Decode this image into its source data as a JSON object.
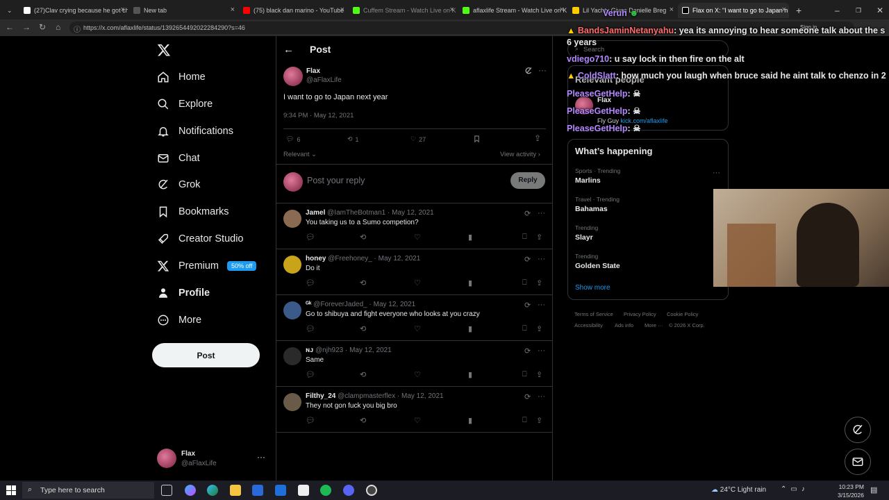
{
  "browser": {
    "tabs": [
      {
        "label": "(27)Clav crying because he got ch",
        "color": "#ffffff"
      },
      {
        "label": "New tab",
        "color": "#cccccc"
      },
      {
        "label": "(75) black dan marino - YouTube",
        "color": "#ff0000"
      },
      {
        "label": "Cuffem Stream - Watch Live on K",
        "color": "#53fc18"
      },
      {
        "label": "aflaxlife Stream - Watch Live on K",
        "color": "#53fc18"
      },
      {
        "label": "Lil Yachty Gives Danielle Breg",
        "color": "#ffcc00"
      },
      {
        "label": "Flax on X: \"I want to go to Japan n",
        "color": "#ffffff"
      }
    ],
    "url": "https://x.com/aflaxlife/status/1392654492022284290?s=46",
    "signin_label": "Sign in"
  },
  "nav": {
    "items": [
      {
        "label": "Home",
        "icon": "home-icon"
      },
      {
        "label": "Explore",
        "icon": "search-icon"
      },
      {
        "label": "Notifications",
        "icon": "bell-icon"
      },
      {
        "label": "Chat",
        "icon": "mail-icon"
      },
      {
        "label": "Grok",
        "icon": "grok-icon"
      },
      {
        "label": "Bookmarks",
        "icon": "bookmark-icon"
      },
      {
        "label": "Creator Studio",
        "icon": "rocket-icon"
      },
      {
        "label": "Premium",
        "icon": "x-icon",
        "badge": "50% off"
      },
      {
        "label": "Profile",
        "icon": "person-icon"
      },
      {
        "label": "More",
        "icon": "more-icon"
      }
    ],
    "post_label": "Post",
    "account": {
      "name": "Flax",
      "handle": "@aFlaxLife",
      "more": "···"
    }
  },
  "post": {
    "header_title": "Post",
    "author_name": "Flax",
    "author_handle": "@aFlaxLife",
    "text": "I want to go to Japan next year",
    "timestamp": "9:34 PM · May 12, 2021",
    "replies": "6",
    "reposts": "1",
    "likes": "27",
    "sort_label": "Relevant",
    "view_activity": "View activity",
    "reply_placeholder": "Post your reply",
    "reply_button": "Reply"
  },
  "replies": [
    {
      "name": "Jamel",
      "handle": "@IamTheBotman1",
      "date": "May 12, 2021",
      "text": "You taking us to a Sumo competion?",
      "color": "#8a6a50"
    },
    {
      "name": "honey",
      "handle": "@Freehoney_",
      "date": "May 12, 2021",
      "text": "Do it",
      "color": "#c9a31a"
    },
    {
      "name": "ᴳᵏ",
      "handle": "@ForeverJaded_",
      "date": "May 12, 2021",
      "text": "Go to shibuya and fight everyone who looks at you crazy",
      "color": "#3b5a8a"
    },
    {
      "name": "ɴᴊ",
      "handle": "@njh923",
      "date": "May 12, 2021",
      "text": "Same",
      "color": "#2a2a2a"
    },
    {
      "name": "Filthy_24",
      "handle": "@clampmasterflex",
      "date": "May 12, 2021",
      "text": "They not gon fuck you big bro",
      "color": "#6a5a48"
    }
  ],
  "right": {
    "search_placeholder": "Search",
    "relevant_title": "Relevant people",
    "relevant_name": "Flax",
    "relevant_bio": "Fly Guy",
    "relevant_link": "kick.com/aflaxlife",
    "happening_title": "What’s happening",
    "trends": [
      {
        "category": "Sports · Trending",
        "name": "Marlins"
      },
      {
        "category": "Travel · Trending",
        "name": "Bahamas"
      },
      {
        "category": "Trending",
        "name": "Slayr"
      },
      {
        "category": "Trending",
        "name": "Golden State"
      }
    ],
    "show_more": "Show more",
    "footer": [
      "Terms of Service",
      "Privacy Policy",
      "Cookie Policy",
      "Accessibility",
      "Ads info",
      "More ···",
      "© 2026 X Corp."
    ]
  },
  "chat": [
    {
      "user": "Veruh",
      "msg": ""
    },
    {
      "user": "BandsJaminNetanyahu",
      "msg": "yea its annoying to hear someone talk about the s"
    },
    {
      "user": "",
      "msg": "6 years"
    },
    {
      "user": "vdiego710",
      "msg": "u say lock in then fire on the alt"
    },
    {
      "user": "ColdSlatt",
      "msg": "how much you laugh when bruce said he aint talk to chenzo in 2"
    },
    {
      "user": "PleaseGetHelp",
      "msg": ""
    },
    {
      "user": "PleaseGetHelp",
      "msg": ""
    },
    {
      "user": "PleaseGetHelp",
      "msg": ""
    }
  ],
  "taskbar": {
    "search_placeholder": "Type here to search",
    "weather": "24°C  Light rain",
    "time": "10:23 PM",
    "date": "3/15/2026"
  }
}
